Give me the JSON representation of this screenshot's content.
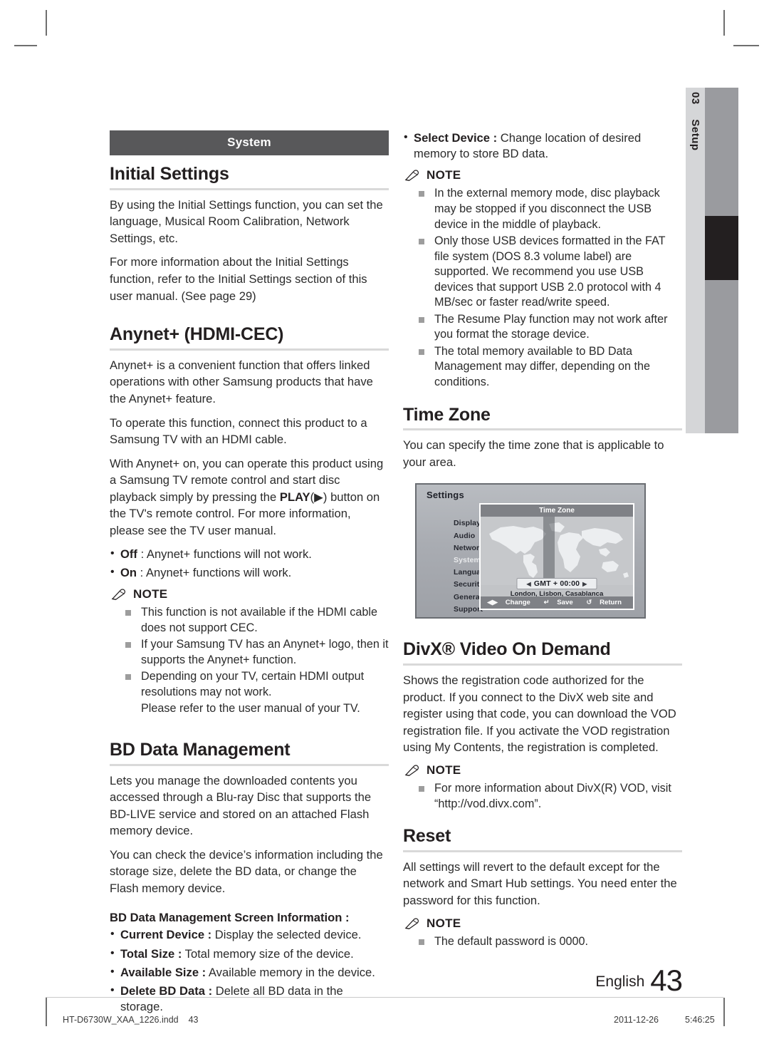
{
  "side_tab": {
    "number": "03",
    "label": "Setup"
  },
  "left_column": {
    "band_label": "System",
    "initial_settings": {
      "heading": "Initial Settings",
      "paragraphs": [
        "By using the Initial Settings function, you can set the language, Musical Room Calibration, Network Settings, etc.",
        "For more information about the Initial Settings function, refer to the Initial Settings section of this user manual. (See page 29)"
      ]
    },
    "anynet": {
      "heading": "Anynet+ (HDMI-CEC)",
      "paragraphs": [
        "Anynet+ is a convenient function that offers linked operations with other Samsung products that have the Anynet+ feature.",
        "To operate this function, connect this product to a Samsung TV with an HDMI cable."
      ],
      "play_sentence_pre": "With Anynet+ on, you can operate this product using a Samsung TV remote control and start disc playback simply by pressing the ",
      "play_bold": "PLAY",
      "play_symbol": "(▶)",
      "play_sentence_post": " button on the TV's remote control. For more information, please see the TV user manual.",
      "options": [
        {
          "term": "Off",
          "desc": " : Anynet+ functions will not work."
        },
        {
          "term": "On",
          "desc": " : Anynet+ functions will work."
        }
      ],
      "note_label": "NOTE",
      "notes": [
        "This function is not available if the HDMI cable does not support CEC.",
        "If your Samsung TV has an Anynet+ logo, then it supports the Anynet+ function.",
        "Depending on your TV, certain HDMI output resolutions may not work."
      ],
      "note_extra": "Please refer to the user manual of your TV."
    },
    "bd_data": {
      "heading": "BD Data Management",
      "paragraphs": [
        "Lets you manage the downloaded contents you accessed through a Blu-ray Disc that supports the BD-LIVE service and stored on an attached Flash memory device.",
        "You can check the device’s information including the storage size, delete the BD data, or change the Flash memory device."
      ],
      "screen_info_heading": "BD Data Management Screen Information :",
      "items": [
        {
          "term": "Current Device :",
          "desc": " Display the selected device."
        },
        {
          "term": "Total Size :",
          "desc": " Total memory size of the device."
        },
        {
          "term": "Available Size :",
          "desc": " Available memory in the device."
        },
        {
          "term": "Delete BD Data :",
          "desc": " Delete all BD data in the storage."
        }
      ]
    }
  },
  "right_column": {
    "select_device": {
      "term": "Select Device :",
      "desc": " Change location of desired memory to store BD data."
    },
    "bd_note": {
      "note_label": "NOTE",
      "notes": [
        "In the external memory mode, disc playback may be stopped if you disconnect the USB device in the middle of playback.",
        "Only those USB devices formatted in the FAT file system (DOS 8.3 volume label) are supported. We recommend you use USB devices that support USB 2.0 protocol with 4 MB/sec or faster read/write speed.",
        "The Resume Play function may not work after you format the storage device.",
        "The total memory available to BD Data Management may differ, depending on the conditions."
      ]
    },
    "time_zone": {
      "heading": "Time Zone",
      "paragraph": "You can specify the time zone that is applicable to your area."
    },
    "osd": {
      "title": "Settings",
      "menu": [
        "Display",
        "Audio",
        "Network",
        "System",
        "Language",
        "Security",
        "General",
        "Support"
      ],
      "selected_menu": "System",
      "panel_title": "Time Zone",
      "gmt_value": "GMT + 00:00",
      "left_arrow": "◀",
      "right_arrow": "▶",
      "city_label": "London, Lisbon, Casablanca",
      "footer": [
        {
          "key": "◀▶",
          "label": "Change"
        },
        {
          "key": "↵",
          "label": "Save"
        },
        {
          "key": "↺",
          "label": "Return"
        }
      ]
    },
    "divx": {
      "heading": "DivX® Video On Demand",
      "paragraph": "Shows the registration code authorized for the product. If you connect to the DivX web site and register using that code, you can download the VOD registration file. If you activate the VOD registration using My Contents, the registration is completed.",
      "note_label": "NOTE",
      "notes": [
        "For more information about DivX(R) VOD, visit “http://vod.divx.com”."
      ]
    },
    "reset": {
      "heading": "Reset",
      "paragraph": "All settings will revert to the default except for the network and Smart Hub settings. You need enter the password for this function.",
      "note_label": "NOTE",
      "notes": [
        "The default password is 0000."
      ]
    }
  },
  "page_footer": {
    "language": "English",
    "page_number": "43"
  },
  "print_footer": {
    "file": "HT-D6730W_XAA_1226.indd",
    "page": "43",
    "date": "2011-12-26",
    "time": "5:46:25"
  }
}
